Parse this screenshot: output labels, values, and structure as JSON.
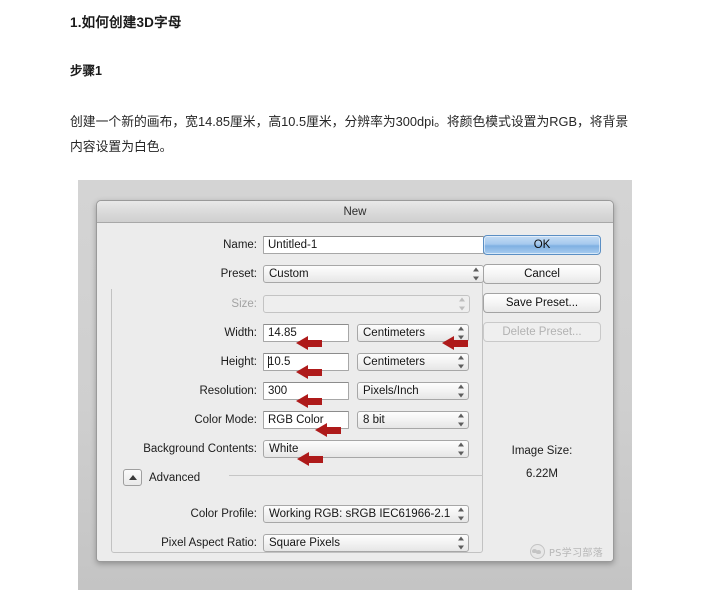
{
  "article": {
    "title": "1.如何创建3D字母",
    "step_heading": "步骤1",
    "body": "创建一个新的画布，宽14.85厘米，高10.5厘米，分辨率为300dpi。将颜色模式设置为RGB，将背景内容设置为白色。"
  },
  "dialog": {
    "title": "New",
    "name": {
      "label": "Name:",
      "value": "Untitled-1"
    },
    "preset": {
      "label": "Preset:",
      "value": "Custom"
    },
    "size": {
      "label": "Size:",
      "value": ""
    },
    "width": {
      "label": "Width:",
      "value": "14.85",
      "unit": "Centimeters"
    },
    "height": {
      "label": "Height:",
      "value": "10.5",
      "unit": "Centimeters"
    },
    "resolution": {
      "label": "Resolution:",
      "value": "300",
      "unit": "Pixels/Inch"
    },
    "color_mode": {
      "label": "Color Mode:",
      "value": "RGB Color",
      "depth": "8 bit"
    },
    "background_contents": {
      "label": "Background Contents:",
      "value": "White"
    },
    "advanced": {
      "label": "Advanced",
      "expanded": true
    },
    "color_profile": {
      "label": "Color Profile:",
      "value": "Working RGB:  sRGB IEC61966-2.1"
    },
    "pixel_aspect_ratio": {
      "label": "Pixel Aspect Ratio:",
      "value": "Square Pixels"
    },
    "buttons": {
      "ok": "OK",
      "cancel": "Cancel",
      "save_preset": "Save Preset...",
      "delete_preset": "Delete Preset..."
    },
    "image_size": {
      "label": "Image Size:",
      "value": "6.22M"
    }
  },
  "watermark": {
    "text": "PS学习部落"
  },
  "colors": {
    "annotation_arrow": "#ae1a1a",
    "primary_button": "#7fb0e2",
    "dialog_background": "#ececec"
  }
}
